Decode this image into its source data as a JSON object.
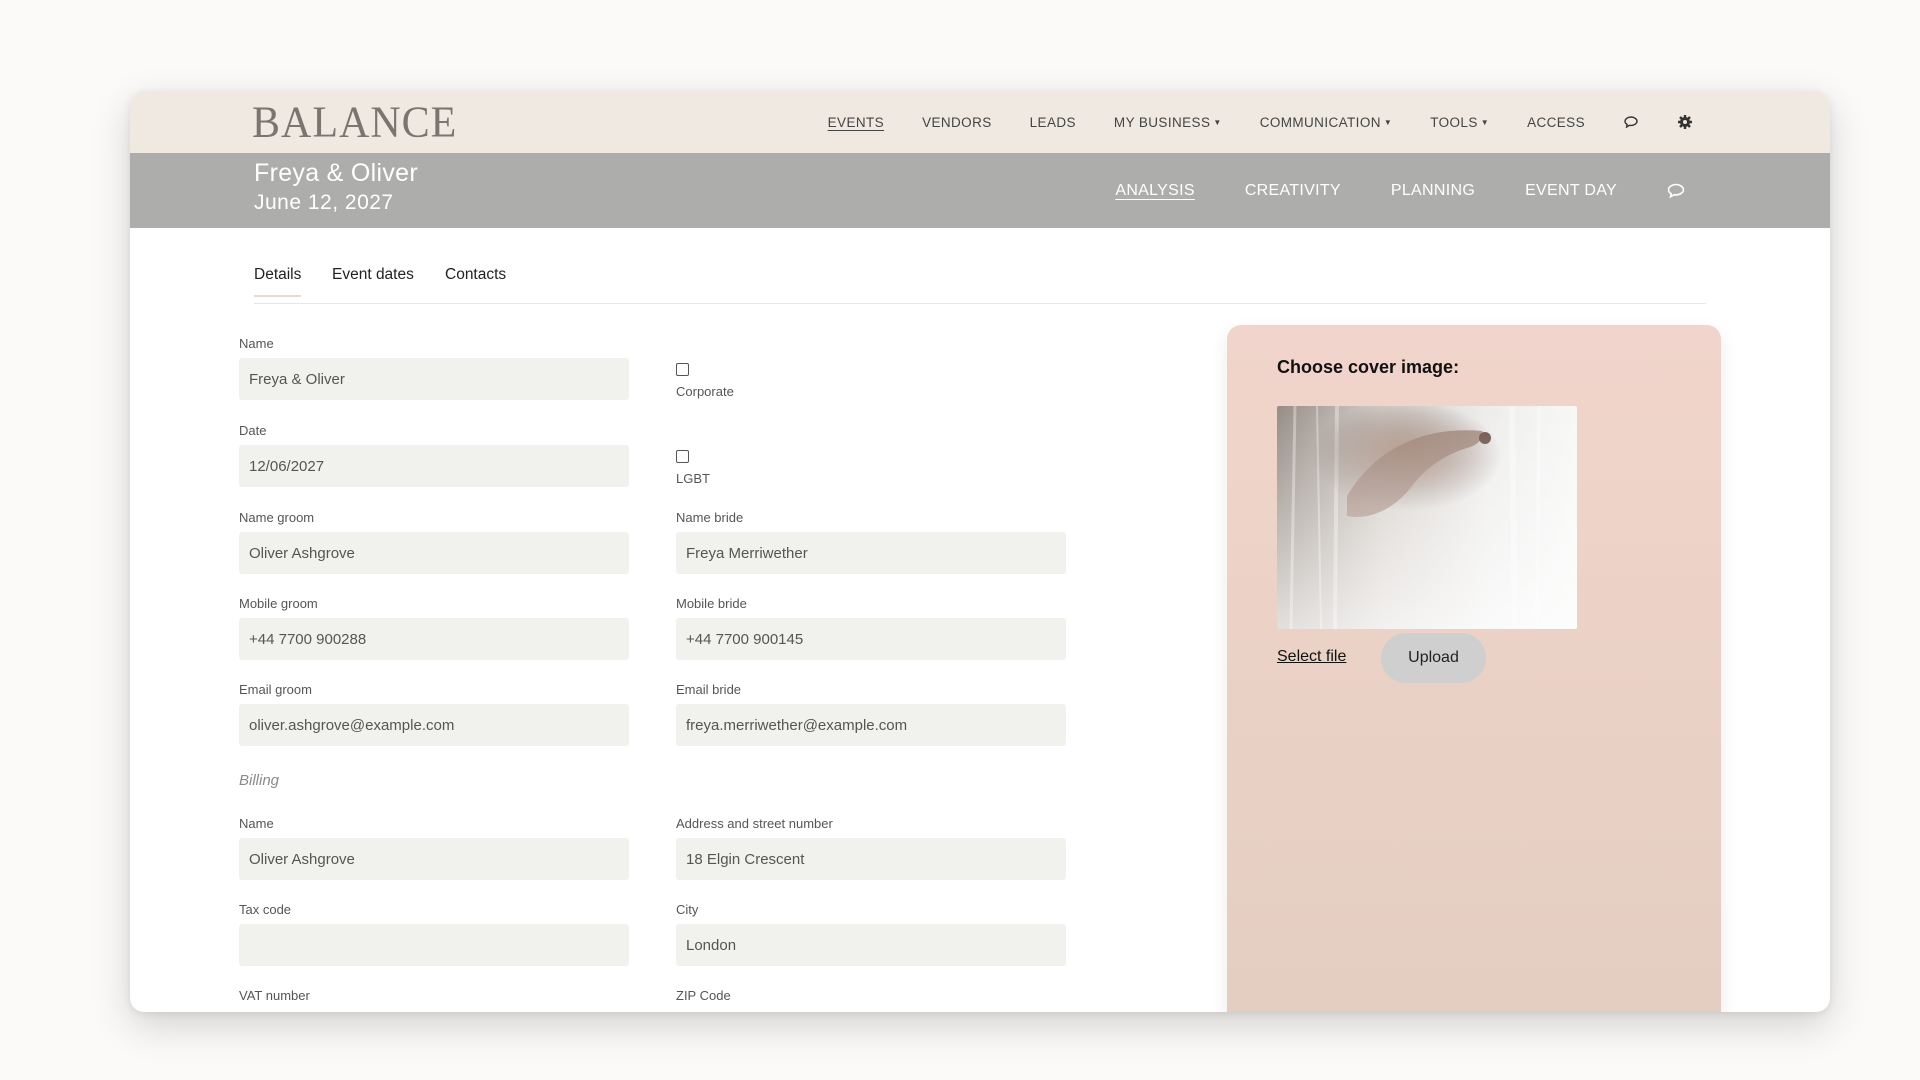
{
  "app": {
    "logo": "BALANCE"
  },
  "topnav": {
    "items": [
      {
        "label": "EVENTS"
      },
      {
        "label": "VENDORS"
      },
      {
        "label": "LEADS"
      },
      {
        "label": "MY BUSINESS"
      },
      {
        "label": "COMMUNICATION"
      },
      {
        "label": "TOOLS"
      },
      {
        "label": "ACCESS"
      }
    ],
    "icons": [
      "chat-icon",
      "gear-icon"
    ]
  },
  "event": {
    "title": "Freya & Oliver",
    "date": "June 12, 2027",
    "phases": [
      {
        "label": "ANALYSIS"
      },
      {
        "label": "CREATIVITY"
      },
      {
        "label": "PLANNING"
      },
      {
        "label": "EVENT DAY"
      }
    ]
  },
  "subtabs": [
    {
      "label": "Details"
    },
    {
      "label": "Event dates"
    },
    {
      "label": "Contacts"
    }
  ],
  "form": {
    "name": {
      "label": "Name",
      "value": "Freya & Oliver"
    },
    "corporate": {
      "label": "Corporate",
      "checked": false
    },
    "date": {
      "label": "Date",
      "value": "12/06/2027"
    },
    "lgbt": {
      "label": "LGBT",
      "checked": false
    },
    "name_groom": {
      "label": "Name groom",
      "value": "Oliver Ashgrove"
    },
    "name_bride": {
      "label": "Name bride",
      "value": "Freya Merriwether"
    },
    "mobile_groom": {
      "label": "Mobile groom",
      "value": "+44 7700 900288"
    },
    "mobile_bride": {
      "label": "Mobile bride",
      "value": "+44 7700 900145"
    },
    "email_groom": {
      "label": "Email groom",
      "value": "oliver.ashgrove@example.com"
    },
    "email_bride": {
      "label": "Email bride",
      "value": "freya.merriwether@example.com"
    }
  },
  "billing": {
    "heading": "Billing",
    "name": {
      "label": "Name",
      "value": "Oliver Ashgrove"
    },
    "address": {
      "label": "Address and street number",
      "value": "18 Elgin Crescent"
    },
    "tax_code": {
      "label": "Tax code",
      "value": ""
    },
    "city": {
      "label": "City",
      "value": "London"
    },
    "vat": {
      "label": "VAT number"
    },
    "zip": {
      "label": "ZIP Code"
    }
  },
  "cover": {
    "title": "Choose cover image:",
    "select_file": "Select file",
    "upload": "Upload"
  },
  "colors": {
    "topnav_bg": "#efe9e1",
    "eventbar_bg": "#adadab",
    "input_bg": "#f1f1ed",
    "cover_panel": "#ecd2c6"
  }
}
